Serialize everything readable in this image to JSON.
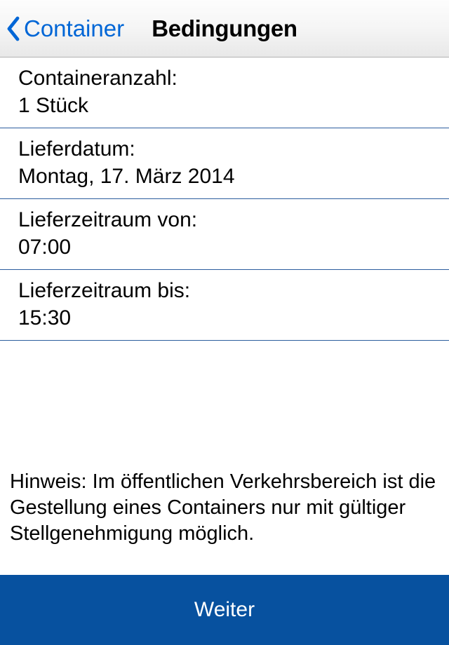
{
  "nav": {
    "back_label": "Container",
    "title": "Bedingungen"
  },
  "rows": [
    {
      "label": "Containeranzahl:",
      "value": "1 Stück"
    },
    {
      "label": "Lieferdatum:",
      "value": "Montag, 17. März 2014"
    },
    {
      "label": "Lieferzeitraum von:",
      "value": "07:00"
    },
    {
      "label": "Lieferzeitraum bis:",
      "value": "15:30"
    }
  ],
  "hint_text": "Hinweis: Im öffentlichen Verkehrsbereich ist die Gestellung eines Containers nur mit gültiger Stellgenehmigung möglich.",
  "continue_label": "Weiter",
  "colors": {
    "accent": "#0066d6",
    "row_border": "#2c5d9e",
    "primary_button": "#07519f"
  }
}
